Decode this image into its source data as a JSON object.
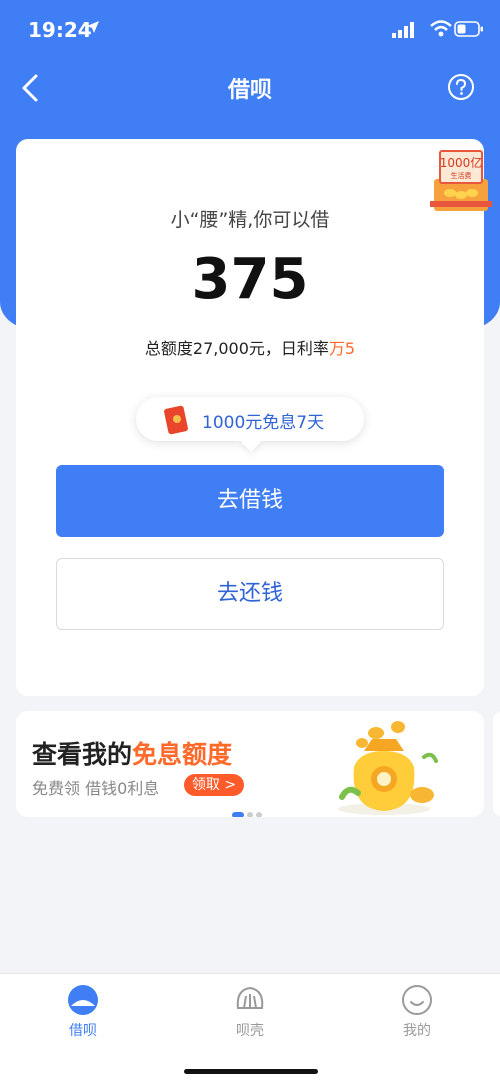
{
  "status_bar": {
    "time": "19:24"
  },
  "nav": {
    "title": "借呗"
  },
  "main_card": {
    "gift_badge": {
      "amount": "1000亿",
      "caption": "生活费"
    },
    "greeting": "小“腰”精,你可以借",
    "available_amount": "375",
    "limit_text": "总额度27,000元，日利率",
    "rate_value": "万5",
    "promo_text": "1000元免息7天",
    "borrow_button": "去借钱",
    "repay_button": "去还钱"
  },
  "banner": {
    "title_prefix": "查看我的",
    "title_highlight": "免息额度",
    "subtitle": "免费领 借钱0利息",
    "claim_label": "领取 >"
  },
  "tabs": [
    {
      "label": "借呗",
      "icon": "jiebei-icon",
      "active": true
    },
    {
      "label": "呗壳",
      "icon": "beike-icon",
      "active": false
    },
    {
      "label": "我的",
      "icon": "smiley-icon",
      "active": false
    }
  ],
  "colors": {
    "brand_blue": "#3f7ef4",
    "accent_orange": "#ff6a2a"
  }
}
